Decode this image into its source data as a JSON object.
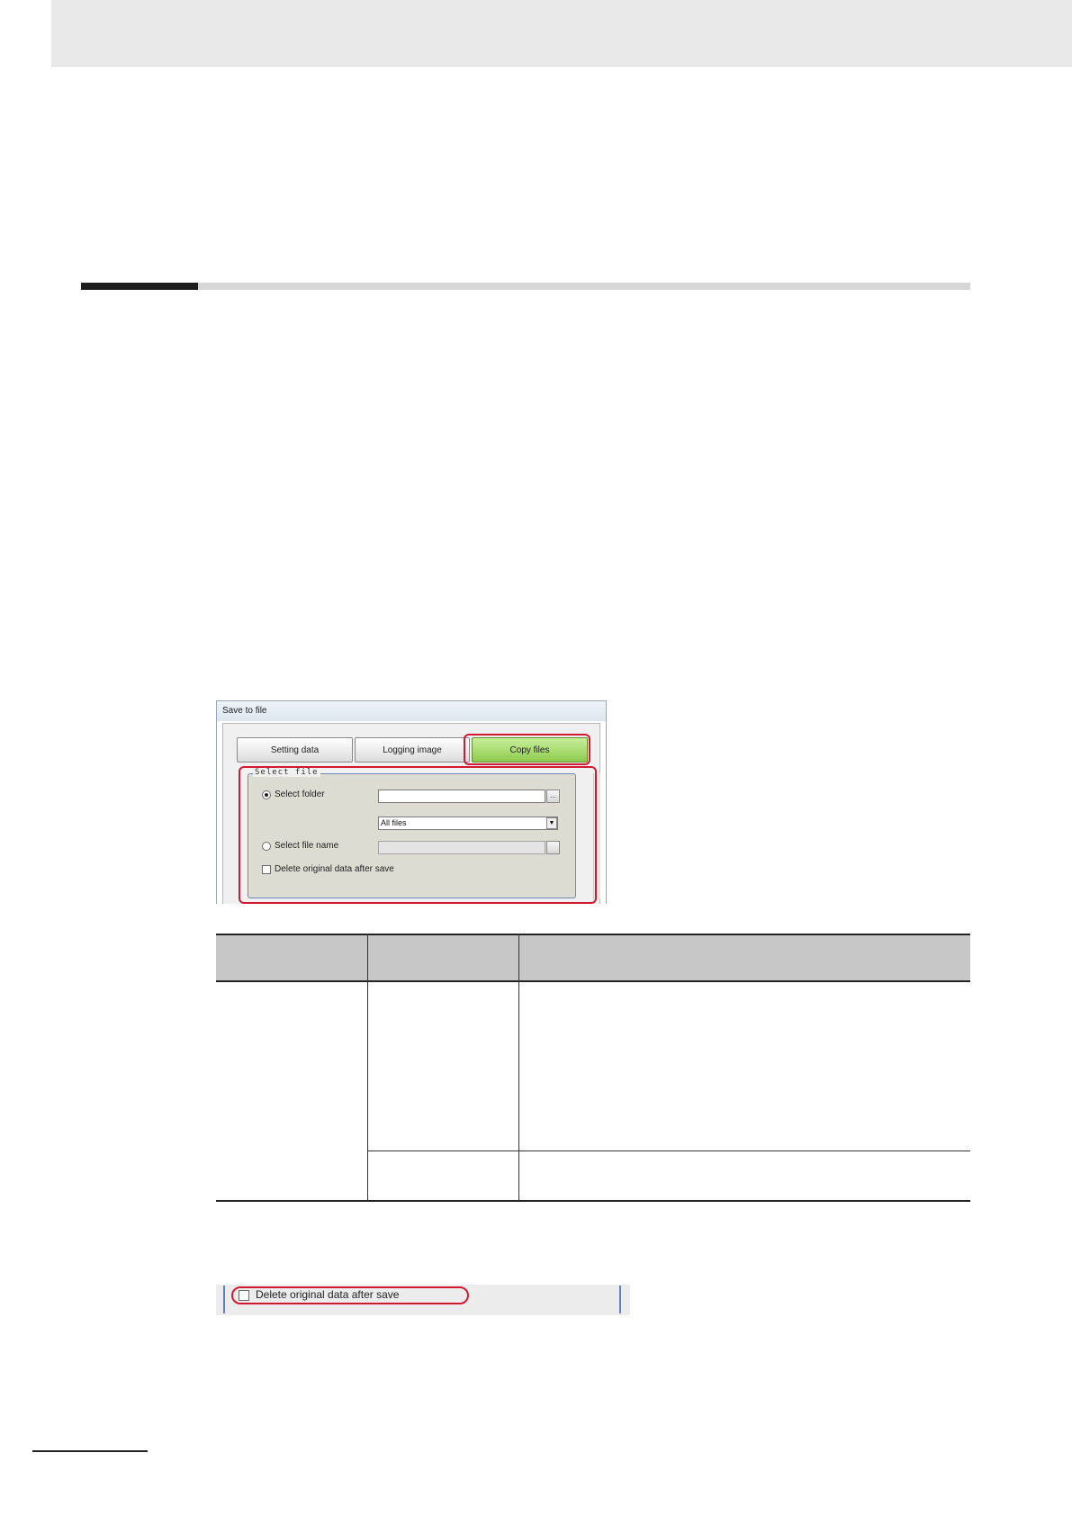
{
  "dialog": {
    "title": "Save to file",
    "tabs": [
      {
        "label": "Setting data"
      },
      {
        "label": "Logging image"
      },
      {
        "label": "Copy files"
      }
    ],
    "active_tab": "Copy files",
    "group": {
      "legend": "Select file",
      "select_folder_label": "Select folder",
      "select_folder_checked": true,
      "folder_path_value": "",
      "browse_label": "...",
      "file_type_value": "All files",
      "select_file_name_label": "Select file name",
      "select_file_name_checked": false,
      "file_name_value": "",
      "delete_original_label": "Delete original data after save",
      "delete_original_checked": false
    }
  },
  "table": {
    "headers": [
      "",
      "",
      ""
    ],
    "rows": []
  },
  "checkbox_strip": {
    "label": "Delete original data after save",
    "checked": false
  },
  "colors": {
    "highlight": "#d01a33",
    "active_tab": "#8ecb4f",
    "group_border": "#6f86b8",
    "table_header": "#c7c7c7"
  }
}
